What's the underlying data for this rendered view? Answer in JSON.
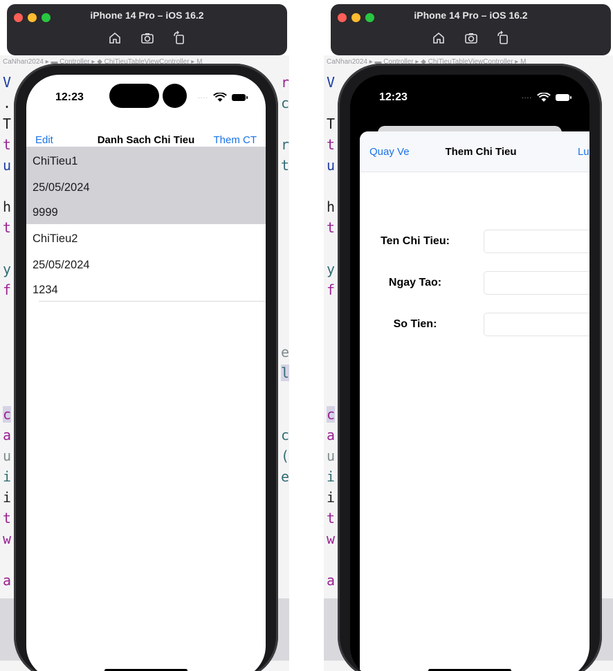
{
  "simulator": {
    "title": "iPhone 14 Pro – iOS 16.2",
    "toolbar_icons": [
      "home-icon",
      "screenshot-icon",
      "rotate-icon"
    ]
  },
  "status_bar": {
    "time": "12:23"
  },
  "list_screen": {
    "nav": {
      "left": "Edit",
      "title": "Danh Sach Chi Tieu",
      "right": "Them CT"
    },
    "items": [
      {
        "name": "ChiTieu1",
        "date": "25/05/2024",
        "amount": "9999",
        "selected": true
      },
      {
        "name": "ChiTieu2",
        "date": "25/05/2024",
        "amount": "1234",
        "selected": false
      }
    ]
  },
  "add_screen": {
    "nav": {
      "left": "Quay Ve",
      "title": "Them Chi Tieu",
      "right": "Luu"
    },
    "fields": [
      {
        "label": "Ten Chi Tieu:",
        "value": ""
      },
      {
        "label": "Ngay Tao:",
        "value": ""
      },
      {
        "label": "So Tien:",
        "value": ""
      }
    ]
  },
  "colors": {
    "accent": "#1a73e8",
    "selected_row": "#d1d1d6",
    "titlebar": "#2b2a2e"
  }
}
